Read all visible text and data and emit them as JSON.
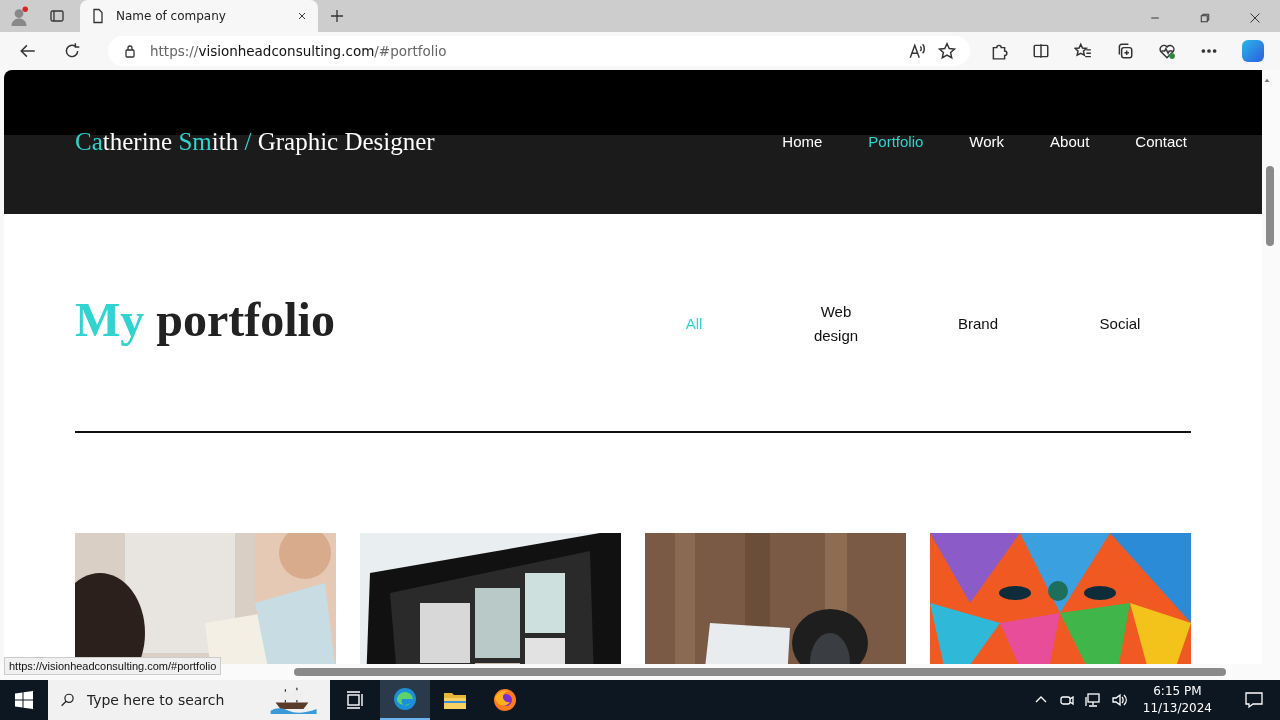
{
  "browser": {
    "tab": {
      "title": "Name of company"
    },
    "address": {
      "scheme": "https://",
      "host": "visionheadconsulting.com",
      "path": "/#portfolio"
    },
    "status_url": "https://visionheadconsulting.com/#portfolio"
  },
  "site": {
    "logo": [
      {
        "text": "Ca",
        "accent": true
      },
      {
        "text": "therine ",
        "accent": false
      },
      {
        "text": "Sm",
        "accent": true
      },
      {
        "text": "ith ",
        "accent": false
      },
      {
        "text": "/",
        "accent": true
      },
      {
        "text": " Graphic Designer",
        "accent": false
      }
    ],
    "nav": [
      {
        "label": "Home",
        "selected": false
      },
      {
        "label": "Portfolio",
        "selected": true
      },
      {
        "label": "Work",
        "selected": false
      },
      {
        "label": "About",
        "selected": false
      },
      {
        "label": "Contact",
        "selected": false
      }
    ],
    "heading": [
      {
        "text": "My",
        "accent": true
      },
      {
        "text": "portfolio",
        "accent": false
      }
    ],
    "filters": [
      {
        "label": "All",
        "selected": true
      },
      {
        "label": "Web design",
        "selected": false
      },
      {
        "label": "Brand",
        "selected": false
      },
      {
        "label": "Social",
        "selected": false
      }
    ]
  },
  "taskbar": {
    "search": {
      "placeholder": "Type here to search"
    },
    "time": "6:15 PM",
    "date": "11/13/2024"
  }
}
